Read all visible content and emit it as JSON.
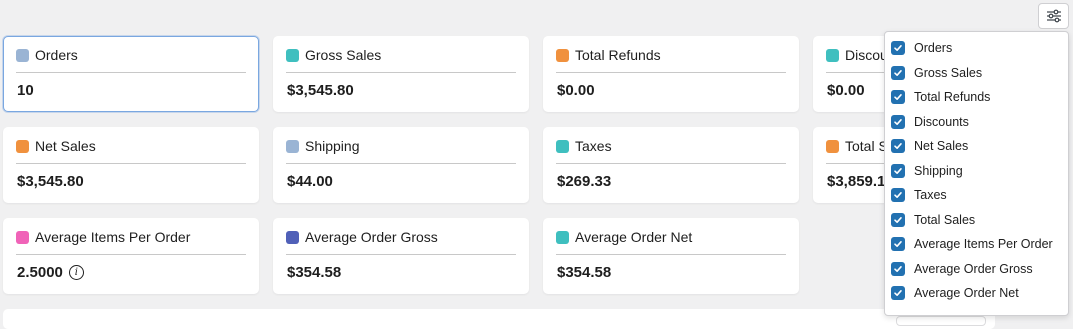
{
  "cards": [
    {
      "label": "Orders",
      "value": "10",
      "color": "#9ab4d4"
    },
    {
      "label": "Gross Sales",
      "value": "$3,545.80",
      "color": "#3fbfbf"
    },
    {
      "label": "Total Refunds",
      "value": "$0.00",
      "color": "#f0913e"
    },
    {
      "label": "Discou",
      "value": "$0.00",
      "color": "#3fbfbf"
    },
    {
      "label": "Net Sales",
      "value": "$3,545.80",
      "color": "#f0913e"
    },
    {
      "label": "Shipping",
      "value": "$44.00",
      "color": "#9ab4d4"
    },
    {
      "label": "Taxes",
      "value": "$269.33",
      "color": "#3fbfbf"
    },
    {
      "label": "Total S",
      "value": "$3,859.1",
      "color": "#f0913e"
    },
    {
      "label": "Average Items Per Order",
      "value": "2.5000",
      "color": "#f063b8",
      "info_icon": "info-icon"
    },
    {
      "label": "Average Order Gross",
      "value": "$354.58",
      "color": "#5060b8"
    },
    {
      "label": "Average Order Net",
      "value": "$354.58",
      "color": "#3fbfbf"
    }
  ],
  "settings_button": {
    "icon": "sliders-icon"
  },
  "column_menu": {
    "options": [
      {
        "label": "Orders",
        "checked": true
      },
      {
        "label": "Gross Sales",
        "checked": true
      },
      {
        "label": "Total Refunds",
        "checked": true
      },
      {
        "label": "Discounts",
        "checked": true
      },
      {
        "label": "Net Sales",
        "checked": true
      },
      {
        "label": "Shipping",
        "checked": true
      },
      {
        "label": "Taxes",
        "checked": true
      },
      {
        "label": "Total Sales",
        "checked": true
      },
      {
        "label": "Average Items Per Order",
        "checked": true
      },
      {
        "label": "Average Order Gross",
        "checked": true
      },
      {
        "label": "Average Order Net",
        "checked": true
      }
    ]
  },
  "colors": {
    "checkbox": "#2271b1",
    "active_border": "#7aa7e0",
    "background": "#f0f0f1"
  }
}
